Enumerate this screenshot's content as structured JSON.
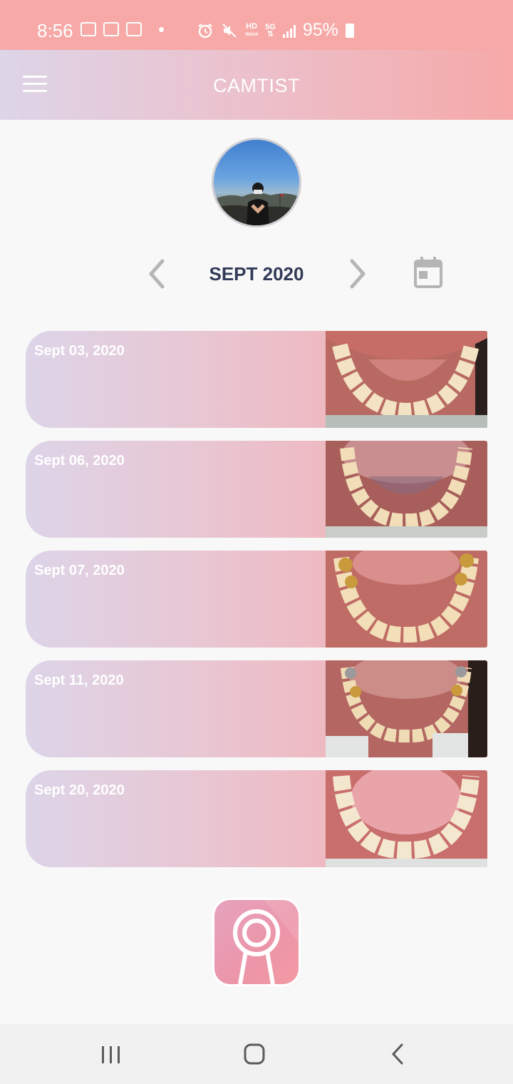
{
  "status_bar": {
    "time": "8:56",
    "battery": "95%",
    "hd_label": "HD",
    "hd_sub": "Voice",
    "network": "5G"
  },
  "app_bar": {
    "title": "CAMTIST",
    "menu_icon": "hamburger-menu-icon"
  },
  "profile": {
    "avatar": "profile-photo"
  },
  "month_nav": {
    "label": "SEPT 2020",
    "prev_icon": "chevron-left-icon",
    "next_icon": "chevron-right-icon",
    "calendar_icon": "calendar-icon"
  },
  "records": [
    {
      "date": "Sept 03, 2020"
    },
    {
      "date": "Sept 06, 2020"
    },
    {
      "date": "Sept 07, 2020"
    },
    {
      "date": "Sept 11, 2020"
    },
    {
      "date": "Sept 20, 2020"
    }
  ],
  "camera_button": {
    "icon": "dental-mirror-icon"
  },
  "nav_bar": {
    "recents_icon": "recent-apps-icon",
    "home_icon": "home-icon",
    "back_icon": "back-icon"
  },
  "colors": {
    "status_bar": "#f6a9a6",
    "gradient_start": "#ddd5e8",
    "gradient_end": "#f6a9a8",
    "month_text": "#313a57",
    "icon_gray": "#b5b5b8"
  }
}
